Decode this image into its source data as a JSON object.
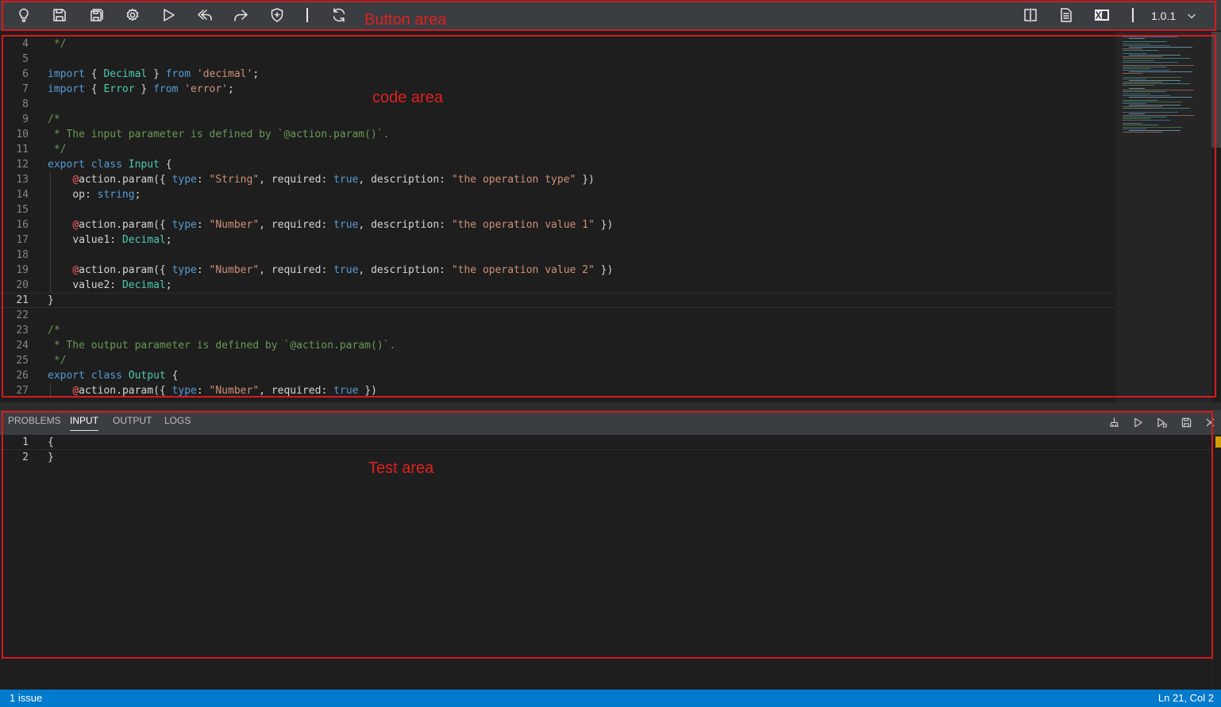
{
  "toolbar": {
    "buttons": [
      {
        "icon": "lightbulb-icon",
        "name": "suggest-button"
      },
      {
        "icon": "save-icon",
        "name": "save-button"
      },
      {
        "icon": "save-as-icon",
        "name": "save-as-button"
      },
      {
        "icon": "gear-icon",
        "name": "settings-button"
      },
      {
        "icon": "play-icon",
        "name": "run-button"
      },
      {
        "icon": "undo-icon",
        "name": "undo-button"
      },
      {
        "icon": "redo-icon",
        "name": "redo-button"
      },
      {
        "icon": "shield-plus-icon",
        "name": "shield-button"
      },
      {
        "icon": "refresh-icon",
        "name": "refresh-button"
      },
      {
        "icon": "split-view-icon",
        "name": "split-view-button"
      },
      {
        "icon": "document-icon",
        "name": "document-button"
      },
      {
        "icon": "excel-icon",
        "name": "excel-button"
      }
    ],
    "version": "1.0.1"
  },
  "annotations": {
    "button_area": "Button area",
    "code_area": "code area",
    "test_area": "Test area"
  },
  "code": {
    "current_line": 21,
    "lines": [
      {
        "n": "4",
        "text": " */"
      },
      {
        "n": "5",
        "text": ""
      },
      {
        "n": "6",
        "text": "import { Decimal } from 'decimal';"
      },
      {
        "n": "7",
        "text": "import { Error } from 'error';"
      },
      {
        "n": "8",
        "text": ""
      },
      {
        "n": "9",
        "text": "/*"
      },
      {
        "n": "10",
        "text": " * The input parameter is defined by `@action.param()`."
      },
      {
        "n": "11",
        "text": " */"
      },
      {
        "n": "12",
        "text": "export class Input {"
      },
      {
        "n": "13",
        "text": "    @action.param({ type: \"String\", required: true, description: \"the operation type\" })"
      },
      {
        "n": "14",
        "text": "    op: string;"
      },
      {
        "n": "15",
        "text": ""
      },
      {
        "n": "16",
        "text": "    @action.param({ type: \"Number\", required: true, description: \"the operation value 1\" })"
      },
      {
        "n": "17",
        "text": "    value1: Decimal;"
      },
      {
        "n": "18",
        "text": ""
      },
      {
        "n": "19",
        "text": "    @action.param({ type: \"Number\", required: true, description: \"the operation value 2\" })"
      },
      {
        "n": "20",
        "text": "    value2: Decimal;"
      },
      {
        "n": "21",
        "text": "}"
      },
      {
        "n": "22",
        "text": ""
      },
      {
        "n": "23",
        "text": "/*"
      },
      {
        "n": "24",
        "text": " * The output parameter is defined by `@action.param()`."
      },
      {
        "n": "25",
        "text": " */"
      },
      {
        "n": "26",
        "text": "export class Output {"
      },
      {
        "n": "27",
        "text": "    @action.param({ type: \"Number\", required: true })"
      }
    ]
  },
  "panel": {
    "tabs": [
      {
        "label": "PROBLEMS",
        "active": false
      },
      {
        "label": "INPUT",
        "active": true
      },
      {
        "label": "OUTPUT",
        "active": false
      },
      {
        "label": "LOGS",
        "active": false
      }
    ],
    "actions": [
      {
        "icon": "clear-icon",
        "name": "clear-button"
      },
      {
        "icon": "play-icon",
        "name": "test-run-button"
      },
      {
        "icon": "run-file-icon",
        "name": "run-file-button"
      },
      {
        "icon": "save-icon",
        "name": "save-input-button"
      },
      {
        "icon": "close-icon",
        "name": "close-panel-button"
      }
    ],
    "input_lines": [
      {
        "n": "1",
        "text": "{"
      },
      {
        "n": "2",
        "text": "}"
      }
    ]
  },
  "status": {
    "issues": "1 issue",
    "position": "Ln 21, Col 2"
  },
  "colors": {
    "keyword": "#569cd6",
    "type": "#4ec9b0",
    "string": "#ce9178",
    "comment": "#6a9955",
    "decorator": "#ff6464",
    "status_bar": "#007acc",
    "annotation": "#d71920"
  }
}
